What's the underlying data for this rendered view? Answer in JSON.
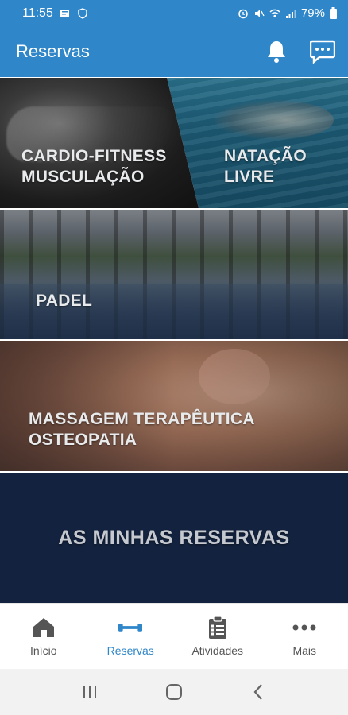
{
  "status_bar": {
    "time": "11:55",
    "battery": "79%"
  },
  "app_bar": {
    "title": "Reservas",
    "icons": [
      "bell-icon",
      "chat-icon"
    ]
  },
  "tiles": {
    "cardio": {
      "line1": "CARDIO-FITNESS",
      "line2": "MUSCULAÇÃO"
    },
    "natacao": {
      "line1": "NATAÇÃO",
      "line2": "LIVRE"
    },
    "padel": {
      "line1": "PADEL"
    },
    "massagem": {
      "line1": "MASSAGEM TERAPÊUTICA",
      "line2": "OSTEOPATIA"
    },
    "minhas_reservas": {
      "line1": "AS MINHAS RESERVAS"
    }
  },
  "bottom_nav": {
    "items": [
      {
        "label": "Início",
        "icon": "home-icon",
        "active": false
      },
      {
        "label": "Reservas",
        "icon": "dumbbell-icon",
        "active": true
      },
      {
        "label": "Atividades",
        "icon": "clipboard-icon",
        "active": false
      },
      {
        "label": "Mais",
        "icon": "more-icon",
        "active": false
      }
    ]
  },
  "colors": {
    "primary": "#2f86c9",
    "reservas_tile": "#13223e",
    "nav_inactive": "#555555"
  }
}
